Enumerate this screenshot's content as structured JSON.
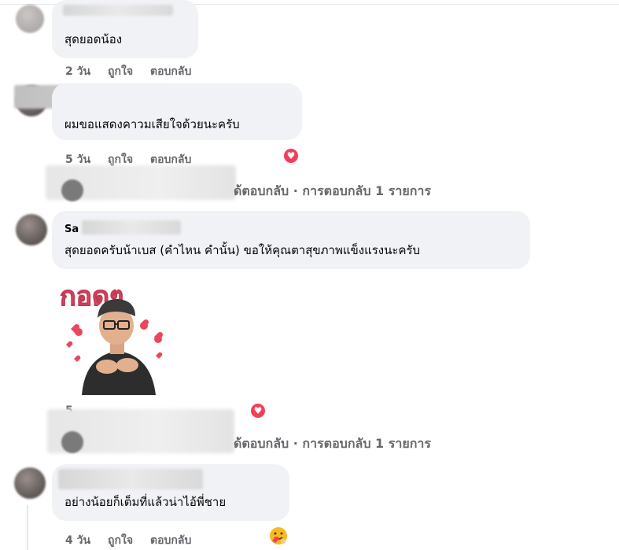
{
  "comments": [
    {
      "text": "สุดยอดน้อง",
      "time": "2 วัน",
      "like": "ถูกใจ",
      "reply": "ตอบกลับ"
    },
    {
      "text": "ผมขอแสดงคาวมเสียใจด้วยนะครับ",
      "time": "5 วัน",
      "like": "ถูกใจ",
      "reply": "ตอบกลับ",
      "reaction": "heart"
    },
    {
      "author_visible": "Sa",
      "text": "สุดยอดครับน้าเบส (คำไหน คำนั้น) ขอให้คุณตาสุขภาพแข็งแรงนะครับ",
      "time": "5",
      "reaction": "heart",
      "sticker_text": "กอดๆ"
    },
    {
      "text": "อย่างน้อยก็เต็มที่แล้วน่าไอ้พี่ชาย",
      "time": "4 วัน",
      "like": "ถูกใจ",
      "reply": "ตอบกลับ",
      "reaction": "hug-emoji"
    }
  ],
  "reply_summaries": [
    {
      "text": "ด้ตอบกลับ · การตอบกลับ 1 รายการ"
    },
    {
      "text": "ด้ตอบกลับ · การตอบกลับ 1 รายการ"
    }
  ],
  "colors": {
    "bubble": "#f0f2f5",
    "meta": "#65676b",
    "heart": "#f33e58"
  }
}
